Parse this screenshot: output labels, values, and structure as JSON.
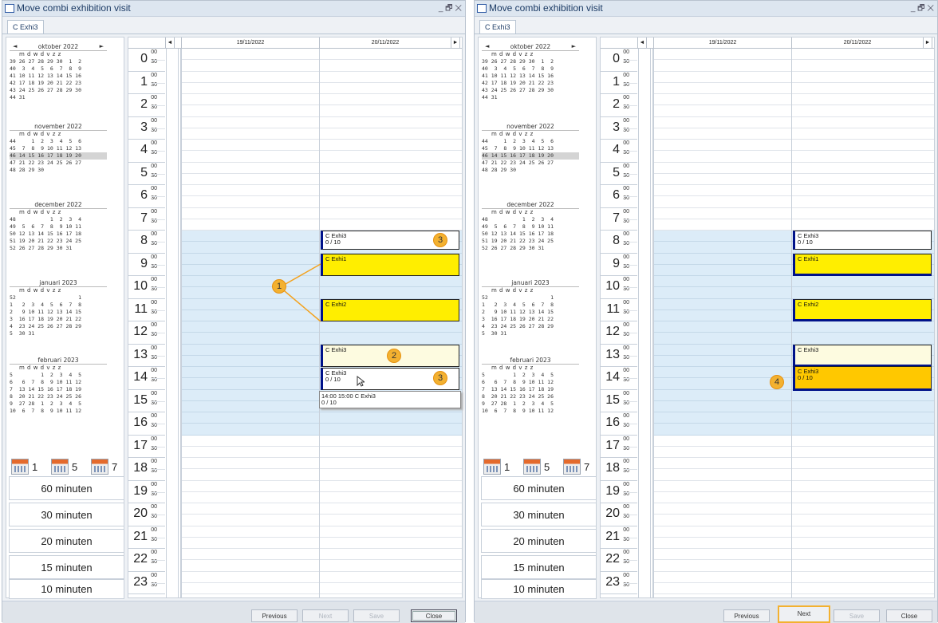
{
  "windows": [
    {
      "title": "Move combi exhibition visit",
      "title_controls": "_ 🗗 ✕",
      "tab": "C Exhi3",
      "grid": {
        "dates": [
          "19/11/2022",
          "20/11/2022"
        ],
        "hours": [
          "0",
          "1",
          "2",
          "3",
          "4",
          "5",
          "6",
          "7",
          "8",
          "9",
          "10",
          "11",
          "12",
          "13",
          "14",
          "15",
          "16",
          "17",
          "18",
          "19",
          "20",
          "21",
          "22",
          "23"
        ],
        "min00": "00",
        "min30": "30",
        "events": [
          {
            "title": "C Exhi3",
            "sub": "0 / 10"
          },
          {
            "title": "C Exhi1",
            "sub": ""
          },
          {
            "title": "C Exhi2",
            "sub": ""
          },
          {
            "title": "C Exhi3",
            "sub": ""
          },
          {
            "title": "C Exhi3",
            "sub": "0 / 10"
          }
        ],
        "tooltip": {
          "line1": "14:00  15:00   C Exhi3",
          "line2": "0 / 10"
        },
        "badges": [
          "1",
          "3",
          "2",
          "3"
        ]
      },
      "buttons": {
        "previous": "Previous",
        "next": "Next",
        "save": "Save",
        "close": "Close"
      }
    },
    {
      "title": "Move combi exhibition visit",
      "title_controls": "_ 🗗 ✕",
      "tab": "C Exhi3",
      "grid": {
        "dates": [
          "19/11/2022",
          "20/11/2022"
        ],
        "hours": [
          "0",
          "1",
          "2",
          "3",
          "4",
          "5",
          "6",
          "7",
          "8",
          "9",
          "10",
          "11",
          "12",
          "13",
          "14",
          "15",
          "16",
          "17",
          "18",
          "19",
          "20",
          "21",
          "22",
          "23"
        ],
        "min00": "00",
        "min30": "30",
        "events": [
          {
            "title": "C Exhi3",
            "sub": "0 / 10"
          },
          {
            "title": "C Exhi1",
            "sub": ""
          },
          {
            "title": "C Exhi2",
            "sub": ""
          },
          {
            "title": "C Exhi3",
            "sub": ""
          },
          {
            "title": "C Exhi3",
            "sub": "0 / 10"
          }
        ],
        "badges": [
          "4"
        ]
      },
      "buttons": {
        "previous": "Previous",
        "next": "Next",
        "save": "Save",
        "close": "Close"
      }
    }
  ],
  "mini_calendar": {
    "nav_prev": "◄",
    "nav_next": "►",
    "day_header": "m d w d v z z",
    "months": [
      {
        "name": "oktober 2022",
        "weeks": [
          "39 26 27 28 29 30  1  2",
          "40  3  4  5  6  7  8  9",
          "41 10 11 12 13 14 15 16",
          "42 17 18 19 20 21 22 23",
          "43 24 25 26 27 28 29 30",
          "44 31"
        ]
      },
      {
        "name": "november 2022",
        "weeks": [
          "44     1  2  3  4  5  6",
          "45  7  8  9 10 11 12 13",
          "46 14 15 16 17 18 19 20",
          "47 21 22 23 24 25 26 27",
          "48 28 29 30"
        ]
      },
      {
        "name": "december 2022",
        "weeks": [
          "48           1  2  3  4",
          "49  5  6  7  8  9 10 11",
          "50 12 13 14 15 16 17 18",
          "51 19 20 21 22 23 24 25",
          "52 26 27 28 29 30 31"
        ]
      },
      {
        "name": "januari 2023",
        "weeks": [
          "52                    1",
          "1   2  3  4  5  6  7  8",
          "2   9 10 11 12 13 14 15",
          "3  16 17 18 19 20 21 22",
          "4  23 24 25 26 27 28 29",
          "5  30 31"
        ]
      },
      {
        "name": "februari 2023",
        "weeks": [
          "5         1  2  3  4  5",
          "6   6  7  8  9 10 11 12",
          "7  13 14 15 16 17 18 19",
          "8  20 21 22 23 24 25 26",
          "9  27 28  1  2  3  4  5",
          "10  6  7  8  9 10 11 12"
        ]
      }
    ]
  },
  "view_buttons": [
    "1",
    "5",
    "7"
  ],
  "interval_buttons": [
    "60 minuten",
    "30 minuten",
    "20 minuten",
    "15 minuten",
    "10 minuten"
  ],
  "colors": {
    "event_yellow": "#ffee00",
    "event_orange": "#ffc800",
    "badge": "#f3b130",
    "accent_blue": "#00128a",
    "range_blue": "#dcecf8"
  }
}
